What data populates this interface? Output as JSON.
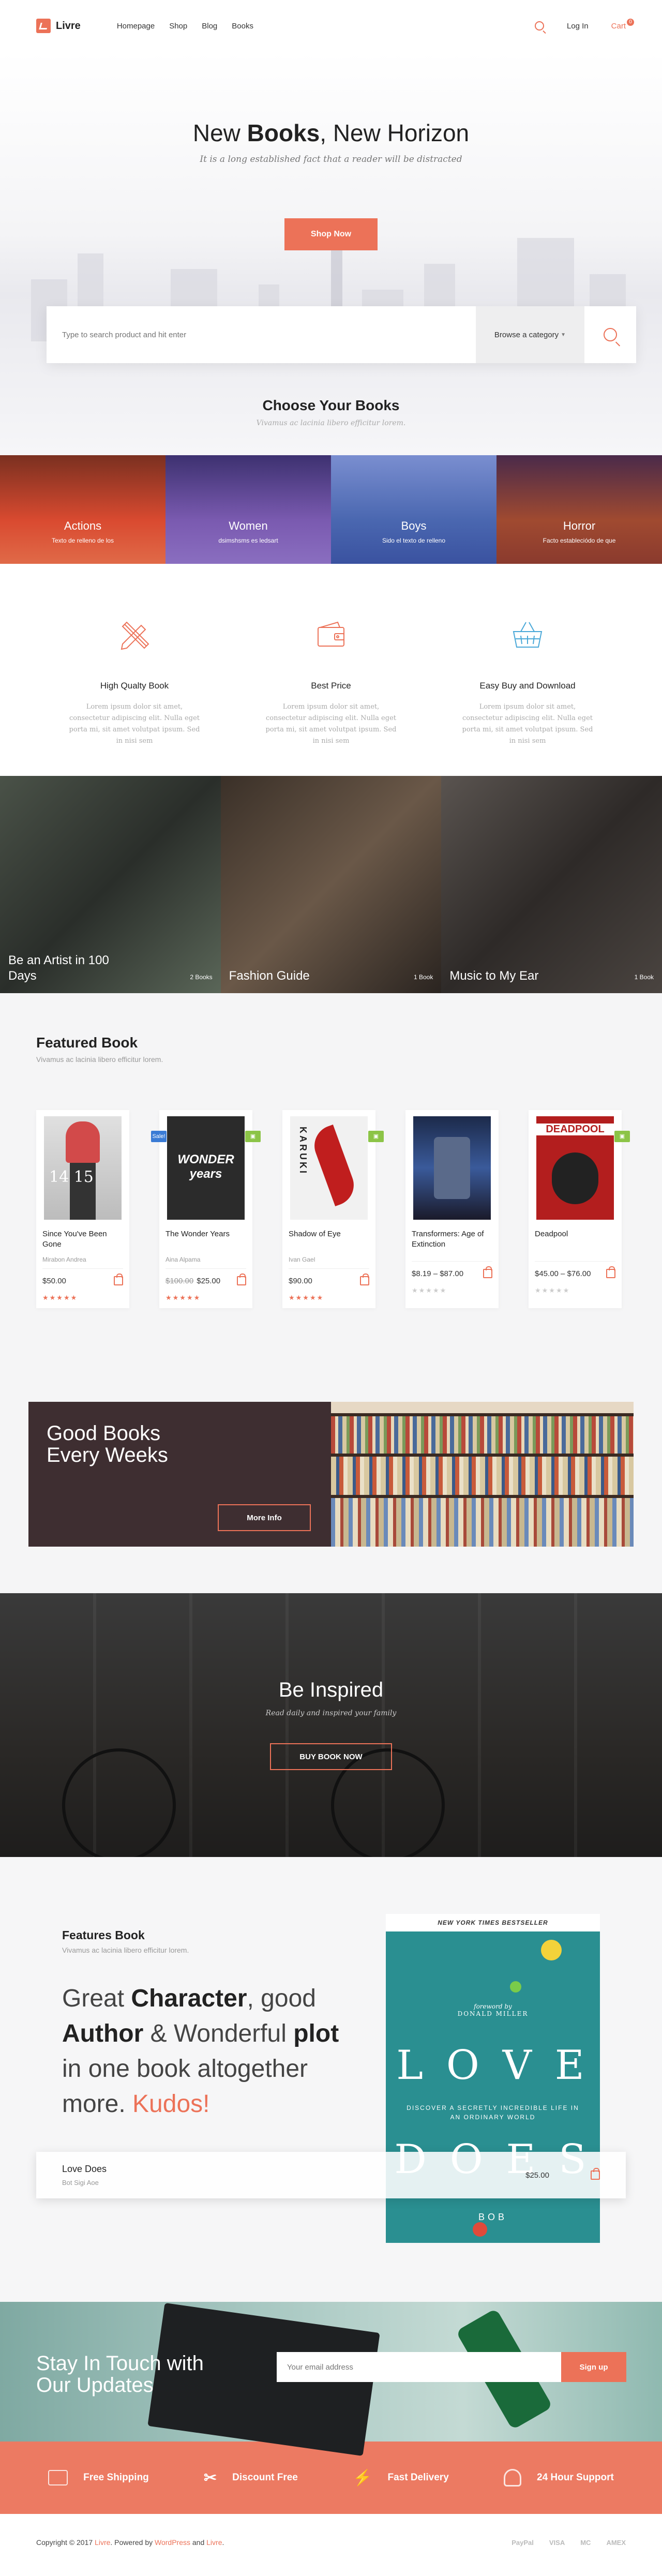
{
  "header": {
    "logo_text": "Livre",
    "nav": [
      "Homepage",
      "Shop",
      "Blog",
      "Books"
    ],
    "login": "Log In",
    "cart": "Cart",
    "cart_count": "0"
  },
  "hero": {
    "title_pre": "New ",
    "title_bold": "Books",
    "title_post": ", New Horizon",
    "subtitle": "It is a long established fact that a reader will be distracted",
    "cta": "Shop Now",
    "search_placeholder": "Type to search product and hit enter",
    "category_select": "Browse a category",
    "choose_title": "Choose Your Books",
    "choose_subtitle": "Vivamus ac lacinia libero efficitur lorem."
  },
  "categories": [
    {
      "title": "Actions",
      "subtitle": "Texto de relleno de los",
      "color": "#c93a2a"
    },
    {
      "title": "Women",
      "subtitle": "dsimshsms es ledsart",
      "color": "#6b4fa0"
    },
    {
      "title": "Boys",
      "subtitle": "Sido el texto de relleno",
      "color": "#4a67b0"
    },
    {
      "title": "Horror",
      "subtitle": "Facto estableciódo de que",
      "color": "#8a3a2e"
    }
  ],
  "features": [
    {
      "title": "High Qualty Book",
      "text": "Lorem ipsum dolor sit amet, consectetur adipiscing elit. Nulla eget porta mi, sit amet volutpat ipsum. Sed in nisi sem"
    },
    {
      "title": "Best Price",
      "text": "Lorem ipsum dolor sit amet, consectetur adipiscing elit. Nulla eget porta mi, sit amet volutpat ipsum. Sed in nisi sem"
    },
    {
      "title": "Easy Buy and Download",
      "text": "Lorem ipsum dolor sit amet, consectetur adipiscing elit. Nulla eget porta mi, sit amet volutpat ipsum. Sed in nisi sem"
    }
  ],
  "gallery": [
    {
      "caption": "Be an Artist in 100 Days",
      "count": "2 Books"
    },
    {
      "caption": "Fashion Guide",
      "count": "1 Book"
    },
    {
      "caption": "Music to My Ear",
      "count": "1 Book"
    }
  ],
  "featured": {
    "title": "Featured Book",
    "subtitle": "Vivamus ac lacinia libero efficitur lorem.",
    "books": [
      {
        "title": "Since You've Been Gone",
        "author": "Mirabon Andrea",
        "price": "$50.00",
        "old_price": "",
        "stars": "★★★★★",
        "rated": true,
        "badge": "",
        "cover": "#d24a4a",
        "cover_text": "14 15"
      },
      {
        "title": "The Wonder Years",
        "author": "Aina Alpama",
        "price": "$25.00",
        "old_price": "$100.00",
        "stars": "★★★★★",
        "rated": true,
        "badge": "Sale!",
        "cover": "#2b2b2b",
        "cover_text": "WONDER years"
      },
      {
        "title": "Shadow of Eye",
        "author": "Ivan Gael",
        "price": "$90.00",
        "old_price": "",
        "stars": "★★★★★",
        "rated": true,
        "badge": "",
        "cover": "#f1f1f1",
        "cover_text": "KARUKI"
      },
      {
        "title": "Transformers: Age of Extinction",
        "author": "",
        "price": "$8.19 – $87.00",
        "old_price": "",
        "stars": "★★★★★",
        "rated": false,
        "badge": "",
        "cover": "#24345a",
        "cover_text": ""
      },
      {
        "title": "Deadpool",
        "author": "",
        "price": "$45.00 – $76.00",
        "old_price": "",
        "stars": "★★★★★",
        "rated": false,
        "badge": "",
        "cover": "#b31e1e",
        "cover_text": "DEADPOOL"
      }
    ]
  },
  "goodbooks": {
    "title": "Good Books Every Weeks",
    "button": "More Info"
  },
  "inspired": {
    "title": "Be Inspired",
    "subtitle": "Read daily and inspired your family",
    "button": "BUY BOOK NOW"
  },
  "features_book": {
    "label": "Features Book",
    "subtitle": "Vivamus ac lacinia libero efficitur lorem.",
    "q1": "Great ",
    "q2": "Character",
    "q3": ", good ",
    "q4": "Author",
    "q5": " & Wonderful ",
    "q6": "plot",
    "q7": " in one book altogether more. ",
    "q8": "Kudos!",
    "bar_title": "Love Does",
    "bar_author": "Bot Sigi Aoe",
    "bar_price": "$25.00",
    "cover_banner": "NEW YORK TIMES BESTSELLER",
    "cover_fw": "foreword by",
    "cover_fw_name": "DONALD MILLER",
    "cover_top": "L O V E",
    "cover_tag": "DISCOVER A SECRETLY INCREDIBLE LIFE IN AN ORDINARY WORLD",
    "cover_bottom": "D O E S",
    "cover_author": "BOB"
  },
  "touch": {
    "title": "Stay In Touch with Our Updates",
    "placeholder": "Your email address",
    "button": "Sign up"
  },
  "perks": [
    "Free Shipping",
    "Discount Free",
    "Fast Delivery",
    "24 Hour Support"
  ],
  "footer": {
    "copy": "Copyright © 2017 ",
    "brand": "Livre",
    "powered": ". Powered by ",
    "wp": "WordPress",
    "and": " and ",
    "brand2": "Livre",
    "dot": ".",
    "payments": [
      "PayPal",
      "VISA",
      "MC",
      "AMEX"
    ]
  }
}
